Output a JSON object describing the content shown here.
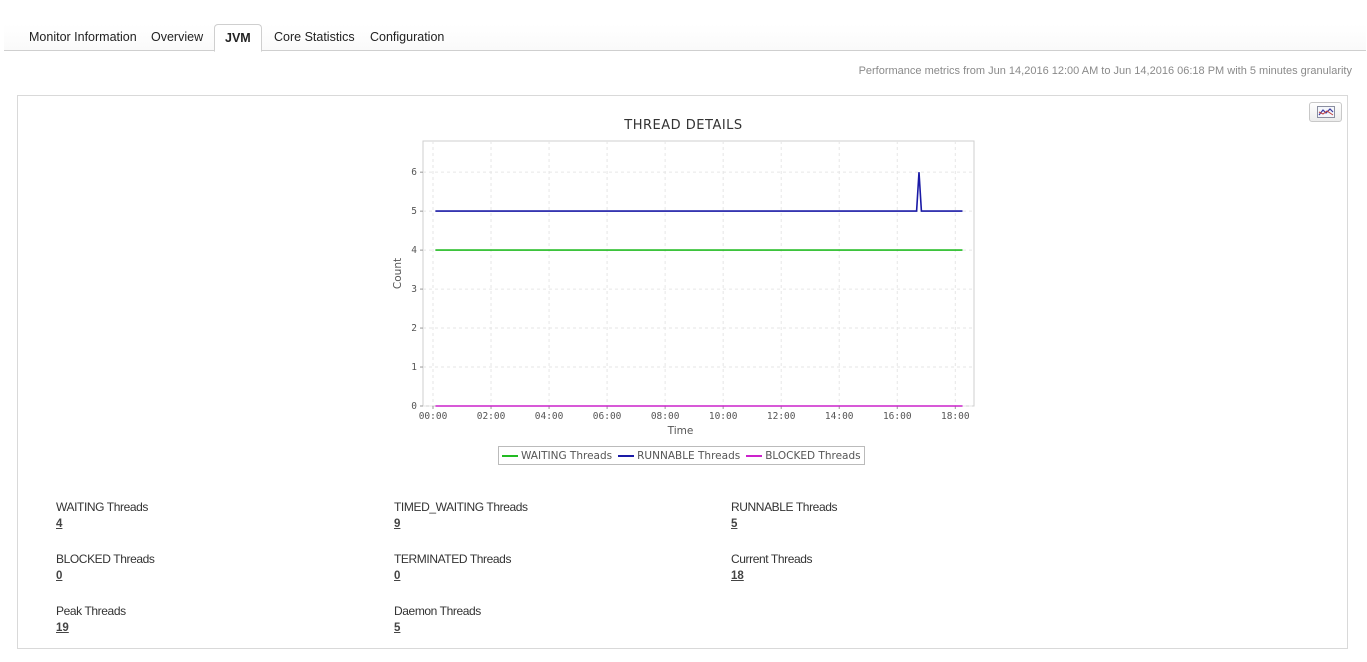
{
  "tabs": [
    {
      "label": "Monitor Information"
    },
    {
      "label": "Overview"
    },
    {
      "label": "JVM"
    },
    {
      "label": "Core Statistics"
    },
    {
      "label": "Configuration"
    }
  ],
  "active_tab": "JVM",
  "perf_note": "Performance metrics from Jun 14,2016 12:00 AM to Jun 14,2016 06:18 PM with 5 minutes granularity",
  "chart_toggle_icon": "chart-icon",
  "chart_data": {
    "type": "line",
    "title": "THREAD DETAILS",
    "xlabel": "Time",
    "ylabel": "Count",
    "x_ticks": [
      "00:00",
      "02:00",
      "04:00",
      "06:00",
      "08:00",
      "10:00",
      "12:00",
      "14:00",
      "16:00",
      "18:00"
    ],
    "y_ticks": [
      "0",
      "1",
      "2",
      "3",
      "4",
      "5",
      "6"
    ],
    "xlim": [
      "00:00",
      "18:18"
    ],
    "ylim": [
      0,
      6.8
    ],
    "grid": true,
    "legend_position": "bottom",
    "series": [
      {
        "name": "WAITING Threads",
        "color": "#22bb22",
        "points": [
          [
            "00:05",
            4
          ],
          [
            "18:15",
            4
          ]
        ]
      },
      {
        "name": "RUNNABLE Threads",
        "color": "#1a1aa6",
        "points": [
          [
            "00:05",
            5
          ],
          [
            "16:40",
            5
          ],
          [
            "16:45",
            6
          ],
          [
            "16:50",
            5
          ],
          [
            "18:15",
            5
          ]
        ]
      },
      {
        "name": "BLOCKED Threads",
        "color": "#cc22cc",
        "points": [
          [
            "00:05",
            0
          ],
          [
            "18:15",
            0
          ]
        ]
      }
    ]
  },
  "metrics": [
    {
      "label": "WAITING Threads",
      "value": "4"
    },
    {
      "label": "TIMED_WAITING Threads",
      "value": "9"
    },
    {
      "label": "RUNNABLE Threads",
      "value": "5"
    },
    {
      "label": "BLOCKED Threads",
      "value": "0"
    },
    {
      "label": "TERMINATED Threads",
      "value": "0"
    },
    {
      "label": "Current Threads",
      "value": "18"
    },
    {
      "label": "Peak Threads",
      "value": "19"
    },
    {
      "label": "Daemon Threads",
      "value": "5"
    }
  ]
}
